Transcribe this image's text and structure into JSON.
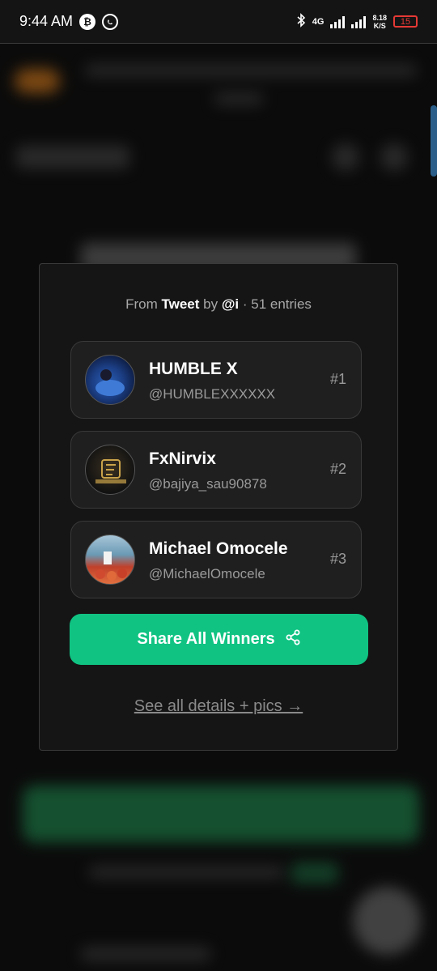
{
  "status_bar": {
    "time": "9:44 AM",
    "network": "4G",
    "speed_value": "8.18",
    "speed_unit": "K/S",
    "battery": "15"
  },
  "modal": {
    "source_prefix": "From",
    "source_type": "Tweet",
    "source_by": "by",
    "source_author": "@i",
    "source_entries": "· 51 entries",
    "winners": [
      {
        "name": "HUMBLE X",
        "handle": "@HUMBLEXXXXXX",
        "rank": "#1"
      },
      {
        "name": "FxNirvix",
        "handle": "@bajiya_sau90878",
        "rank": "#2"
      },
      {
        "name": "Michael Omocele",
        "handle": "@MichaelOmocele",
        "rank": "#3"
      }
    ],
    "share_label": "Share All Winners",
    "details_link": "See all details + pics →"
  },
  "colors": {
    "accent": "#10c383",
    "background": "#0b0b0b",
    "card": "#1f1f1f"
  }
}
